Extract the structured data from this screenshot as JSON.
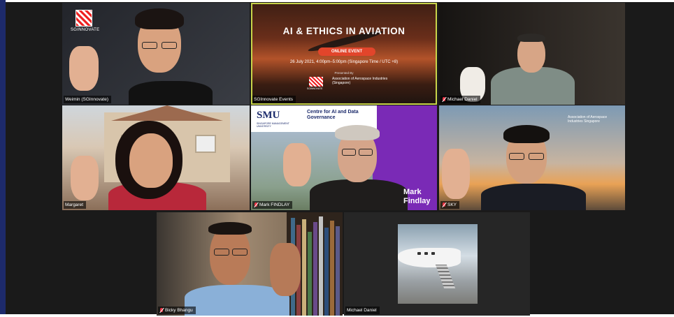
{
  "tiles": [
    {
      "name": "Weimin (SGInnovate)",
      "muted": false,
      "logo_text": "SGINNOVATE"
    },
    {
      "name": "SGInnovate Events",
      "muted": false,
      "active_speaker": true
    },
    {
      "name": "Michael Daniel",
      "muted": true
    },
    {
      "name": "Margaret",
      "muted": false
    },
    {
      "name": "Mark FINDLAY",
      "muted": true
    },
    {
      "name": "SKY",
      "muted": true
    },
    {
      "name": "Bicky Bhangu",
      "muted": true
    },
    {
      "name": "Michael Daniel",
      "muted": false
    }
  ],
  "event_slide": {
    "title": "AI & ETHICS IN AVIATION",
    "badge": "ONLINE EVENT",
    "date": "26 July 2021, 4:00pm–5:00pm (Singapore Time / UTC +8)",
    "presented_by": "Presented By",
    "logo1": "SGINNOVATE",
    "logo2": "Association of Aerospace Industries (Singapore)"
  },
  "smu_background": {
    "title": "SMU",
    "subtitle": "SINGAPORE MANAGEMENT UNIVERSITY",
    "centre": "Centre for AI and Data Governance",
    "name_line1": "Mark",
    "name_line2": "Findlay"
  },
  "aai_background": {
    "text": "Association of Aerospace Industries Singapore"
  },
  "colors": {
    "active_border": "#c8d44a",
    "event_badge": "#e2452b",
    "smu_purple": "#7a2ab6",
    "muted_icon": "#e34"
  }
}
